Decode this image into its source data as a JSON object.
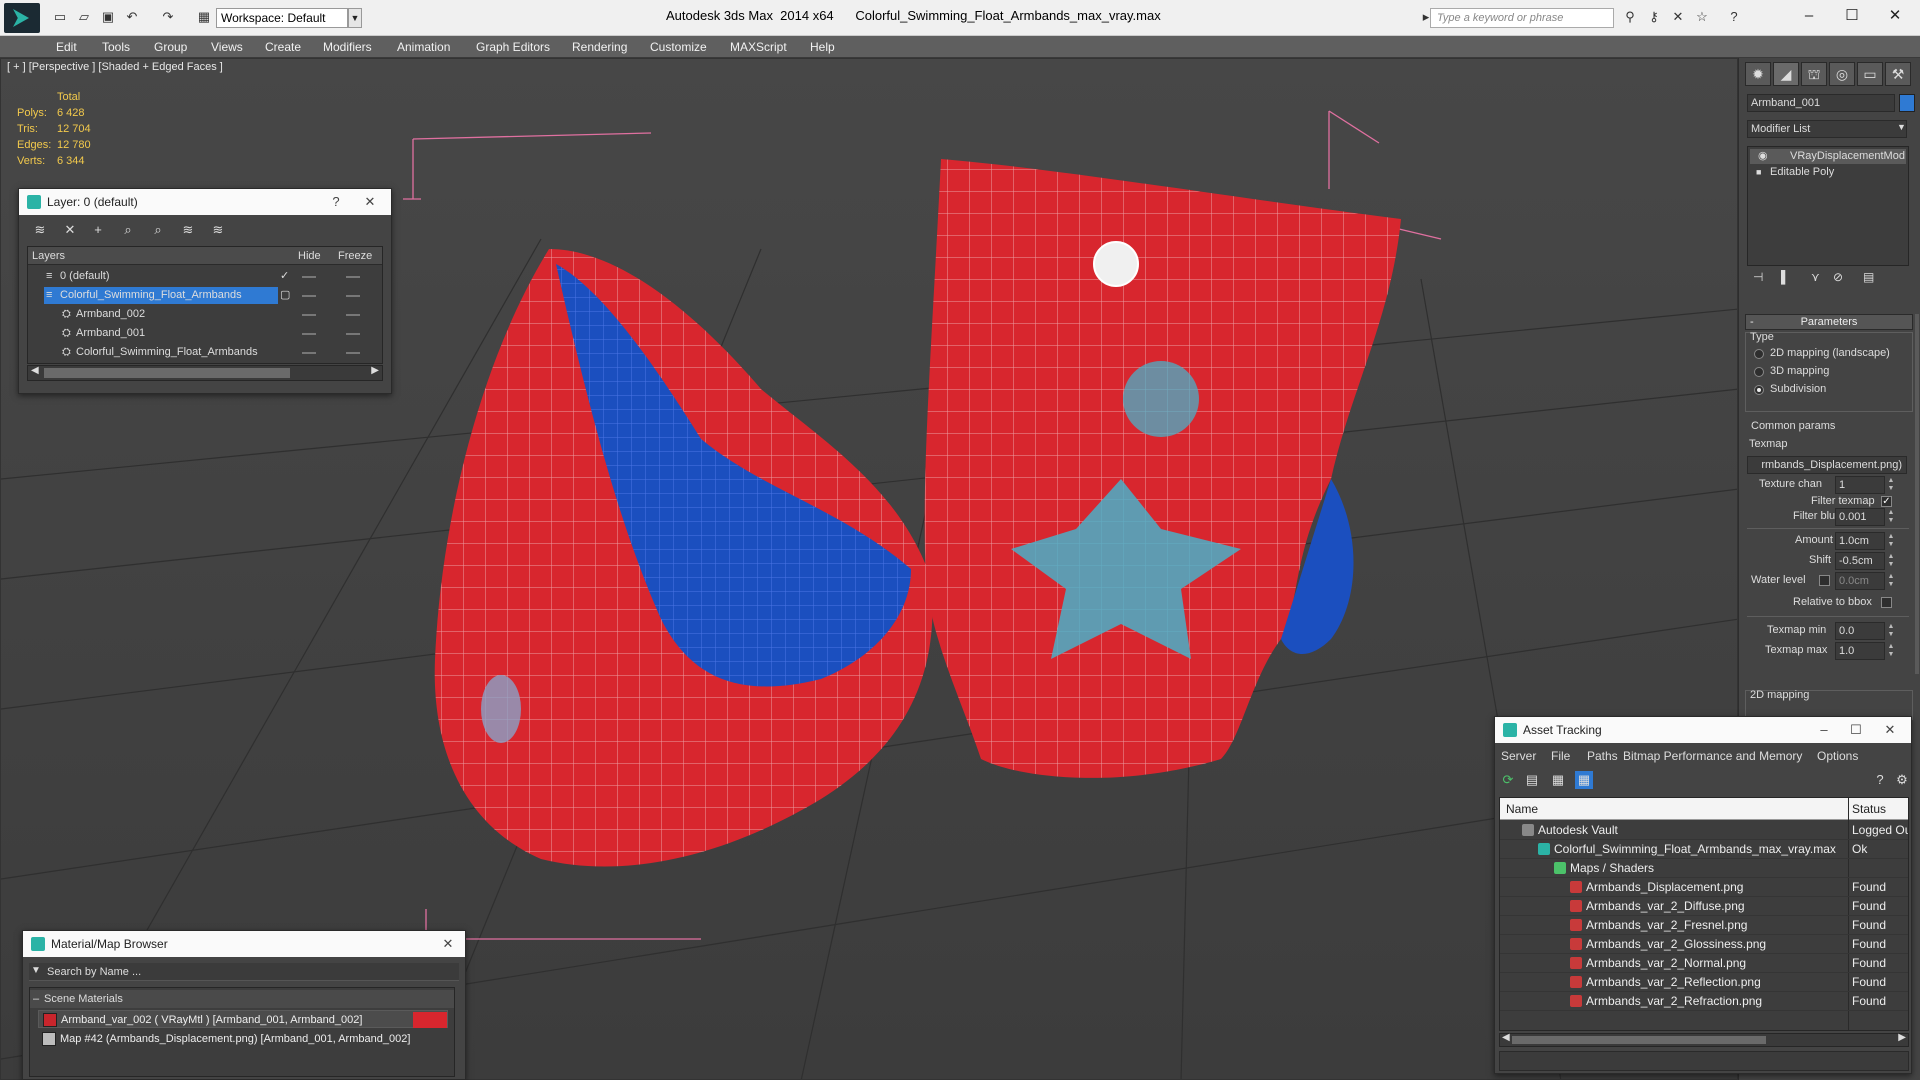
{
  "titlebar": {
    "workspace": "Workspace: Default",
    "app_title": "Autodesk 3ds Max  2014 x64",
    "file_title": "Colorful_Swimming_Float_Armbands_max_vray.max",
    "search_placeholder": "Type a keyword or phrase"
  },
  "menu": [
    "Edit",
    "Tools",
    "Group",
    "Views",
    "Create",
    "Modifiers",
    "Animation",
    "Graph Editors",
    "Rendering",
    "Customize",
    "MAXScript",
    "Help"
  ],
  "viewport": {
    "label": "[ + ] [Perspective ] [Shaded + Edged Faces ]",
    "stats": {
      "header": "Total",
      "rows": [
        {
          "k": "Polys:",
          "v": "6 428"
        },
        {
          "k": "Tris:",
          "v": "12 704"
        },
        {
          "k": "Edges:",
          "v": "12 780"
        },
        {
          "k": "Verts:",
          "v": "6 344"
        }
      ]
    }
  },
  "layer_window": {
    "title": "Layer: 0 (default)",
    "help": "?",
    "columns": {
      "layers": "Layers",
      "hide": "Hide",
      "freeze": "Freeze"
    },
    "rows": [
      {
        "name": "0 (default)"
      },
      {
        "name": "Colorful_Swimming_Float_Armbands"
      },
      {
        "name": "Armband_002"
      },
      {
        "name": "Armband_001"
      },
      {
        "name": "Colorful_Swimming_Float_Armbands"
      }
    ]
  },
  "material_browser": {
    "title": "Material/Map Browser",
    "search_placeholder": "Search by Name ...",
    "group": "Scene Materials",
    "items": [
      "Armband_var_002  ( VRayMtl )  [Armband_001, Armband_002]",
      "Map #42 (Armbands_Displacement.png)  [Armband_001, Armband_002]"
    ]
  },
  "command_panel": {
    "object_name": "Armband_001",
    "modifier_list": "Modifier List",
    "stack": [
      "VRayDisplacementMod",
      "Editable Poly"
    ],
    "parameters_title": "Parameters",
    "type_label": "Type",
    "type_options": [
      "2D mapping (landscape)",
      "3D mapping",
      "Subdivision"
    ],
    "common_params": "Common params",
    "texmap_label": "Texmap",
    "texmap_value": "rmbands_Displacement.png)",
    "texture_chan": {
      "label": "Texture chan",
      "value": "1"
    },
    "filter_texmap": "Filter texmap",
    "filter_blur": {
      "label": "Filter blur",
      "value": "0.001"
    },
    "amount": {
      "label": "Amount",
      "value": "1.0cm"
    },
    "shift": {
      "label": "Shift",
      "value": "-0.5cm"
    },
    "water_level": {
      "label": "Water level",
      "value": "0.0cm"
    },
    "relative_bbox": "Relative to bbox",
    "texmap_min": {
      "label": "Texmap min",
      "value": "0.0"
    },
    "texmap_max": {
      "label": "Texmap max",
      "value": "1.0"
    },
    "mapping_2d": "2D mapping"
  },
  "asset_tracking": {
    "title": "Asset Tracking",
    "menu": [
      "Server",
      "File",
      "Paths",
      "Bitmap Performance and Memory",
      "Options"
    ],
    "columns": {
      "name": "Name",
      "status": "Status"
    },
    "rows": [
      {
        "name": "Autodesk Vault",
        "status": "Logged Ou"
      },
      {
        "name": "Colorful_Swimming_Float_Armbands_max_vray.max",
        "status": "Ok"
      },
      {
        "name": "Maps / Shaders",
        "status": ""
      },
      {
        "name": "Armbands_Displacement.png",
        "status": "Found"
      },
      {
        "name": "Armbands_var_2_Diffuse.png",
        "status": "Found"
      },
      {
        "name": "Armbands_var_2_Fresnel.png",
        "status": "Found"
      },
      {
        "name": "Armbands_var_2_Glossiness.png",
        "status": "Found"
      },
      {
        "name": "Armbands_var_2_Normal.png",
        "status": "Found"
      },
      {
        "name": "Armbands_var_2_Reflection.png",
        "status": "Found"
      },
      {
        "name": "Armbands_var_2_Refraction.png",
        "status": "Found"
      }
    ]
  },
  "colors": {
    "armband_red": "#d8262e",
    "armband_blue": "#1b4fbf",
    "selection_blue": "#2f7ad3",
    "stats_yellow": "#f2c94c"
  }
}
